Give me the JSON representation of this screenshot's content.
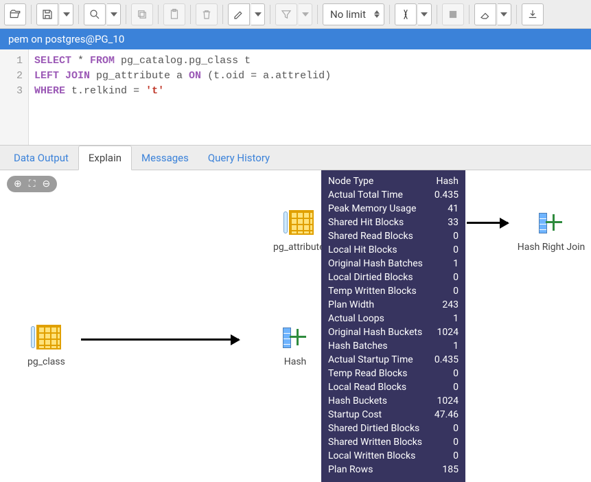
{
  "toolbar": {
    "limit": "No limit"
  },
  "titlebar": "pem on postgres@PG_10",
  "editor": {
    "lines": [
      1,
      2,
      3
    ],
    "sql_tokens": [
      [
        {
          "t": "SELECT",
          "c": "kw"
        },
        {
          "t": " * ",
          "c": "op"
        },
        {
          "t": "FROM",
          "c": "kw"
        },
        {
          "t": " pg_catalog",
          "c": "fn"
        },
        {
          "t": ".",
          "c": "op"
        },
        {
          "t": "pg_class t",
          "c": "fn"
        }
      ],
      [
        {
          "t": "LEFT JOIN",
          "c": "kw"
        },
        {
          "t": " pg_attribute a ",
          "c": "fn"
        },
        {
          "t": "ON",
          "c": "kw"
        },
        {
          "t": " (",
          "c": "op"
        },
        {
          "t": "t",
          "c": "fn"
        },
        {
          "t": ".",
          "c": "op"
        },
        {
          "t": "oid ",
          "c": "fn"
        },
        {
          "t": "= ",
          "c": "op"
        },
        {
          "t": "a",
          "c": "fn"
        },
        {
          "t": ".",
          "c": "op"
        },
        {
          "t": "attrelid",
          "c": "fn"
        },
        {
          "t": ")",
          "c": "op"
        }
      ],
      [
        {
          "t": "WHERE",
          "c": "kw"
        },
        {
          "t": " t",
          "c": "fn"
        },
        {
          "t": ".",
          "c": "op"
        },
        {
          "t": "relkind ",
          "c": "fn"
        },
        {
          "t": "= ",
          "c": "op"
        },
        {
          "t": "'t'",
          "c": "lit"
        }
      ]
    ]
  },
  "tabs": [
    "Data Output",
    "Explain",
    "Messages",
    "Query History"
  ],
  "active_tab": "Explain",
  "nodes": {
    "pg_class": "pg_class",
    "pg_attribute": "pg_attribute",
    "hash": "Hash",
    "hash_right_join": "Hash Right Join"
  },
  "tooltip": [
    {
      "k": "Node Type",
      "v": "Hash"
    },
    {
      "k": "Actual Total Time",
      "v": "0.435"
    },
    {
      "k": "Peak Memory Usage",
      "v": "41"
    },
    {
      "k": "Shared Hit Blocks",
      "v": "33"
    },
    {
      "k": "Shared Read Blocks",
      "v": "0"
    },
    {
      "k": "Local Hit Blocks",
      "v": "0"
    },
    {
      "k": "Original Hash Batches",
      "v": "1"
    },
    {
      "k": "Local Dirtied Blocks",
      "v": "0"
    },
    {
      "k": "Temp Written Blocks",
      "v": "0"
    },
    {
      "k": "Plan Width",
      "v": "243"
    },
    {
      "k": "Actual Loops",
      "v": "1"
    },
    {
      "k": "Original Hash Buckets",
      "v": "1024"
    },
    {
      "k": "Hash Batches",
      "v": "1"
    },
    {
      "k": "Actual Startup Time",
      "v": "0.435"
    },
    {
      "k": "Temp Read Blocks",
      "v": "0"
    },
    {
      "k": "Local Read Blocks",
      "v": "0"
    },
    {
      "k": "Hash Buckets",
      "v": "1024"
    },
    {
      "k": "Startup Cost",
      "v": "47.46"
    },
    {
      "k": "Shared Dirtied Blocks",
      "v": "0"
    },
    {
      "k": "Shared Written Blocks",
      "v": "0"
    },
    {
      "k": "Local Written Blocks",
      "v": "0"
    },
    {
      "k": "Plan Rows",
      "v": "185"
    }
  ]
}
